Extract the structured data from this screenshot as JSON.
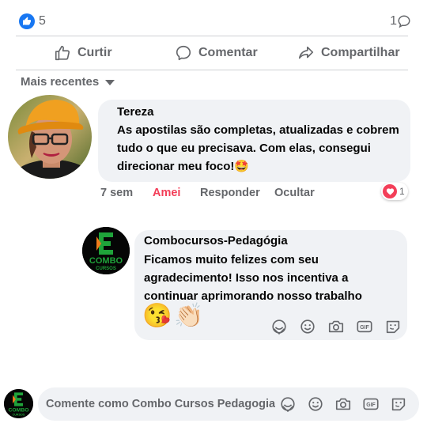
{
  "stats": {
    "reaction_count": "5",
    "comment_count": "1"
  },
  "actions": {
    "like": "Curtir",
    "comment": "Comentar",
    "share": "Compartilhar"
  },
  "sort": {
    "label": "Mais recentes"
  },
  "comment": {
    "author": "Tereza",
    "text": "As apostilas são completas, atualizadas e cobrem tudo o que eu precisava. Com elas, consegui direcionar meu foco!🤩",
    "time": "7 sem",
    "reaction_label": "Amei",
    "reply_label": "Responder",
    "hide_label": "Ocultar",
    "reaction_count": "1",
    "reaction_color": "#f33e58"
  },
  "reply": {
    "author": "Combocursos-Pedagógia",
    "text": "Ficamos muito felizes com seu agradecimento! Isso nos incentiva a continuar aprimorando nosso trabalho",
    "emojis": [
      "😘",
      "👏🏻"
    ]
  },
  "brand": {
    "logo_text_top": "COMBO",
    "logo_text_bottom": "CURSOS",
    "logo_green": "#1fa33a",
    "logo_orange": "#f07c1b"
  },
  "composer": {
    "placeholder": "Comente como Combo Cursos Pedagogia"
  },
  "icons": [
    "like-icon",
    "comment-icon",
    "share-icon",
    "sticker-icon",
    "emoji-icon",
    "camera-icon",
    "gif-icon",
    "avatar-sticker-icon"
  ]
}
